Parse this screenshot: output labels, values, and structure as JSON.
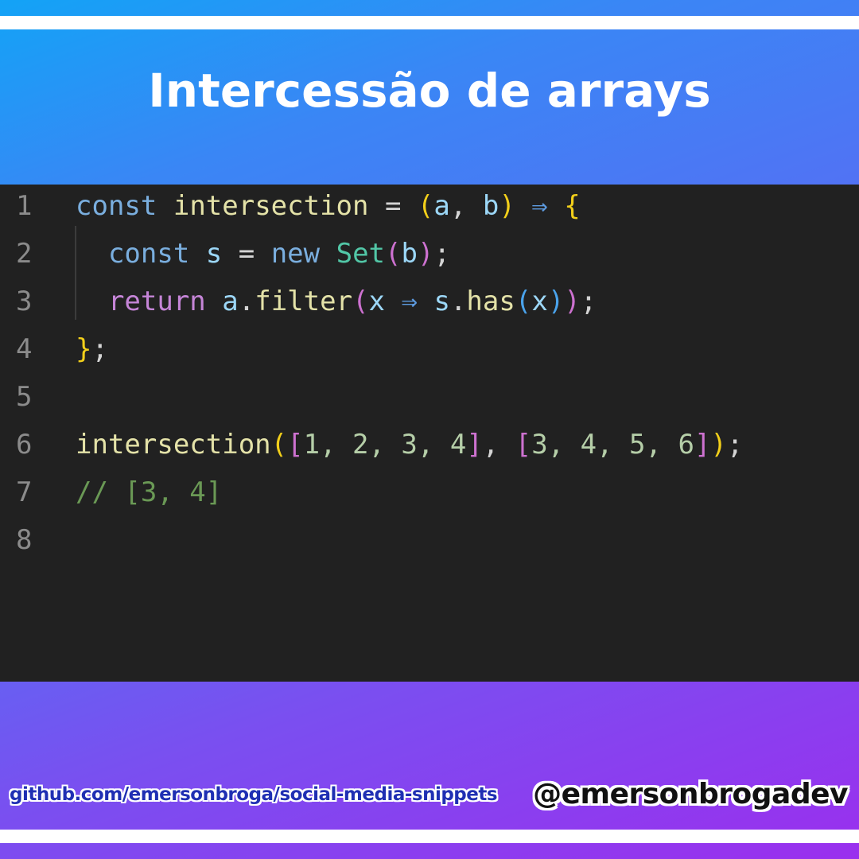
{
  "title": "Intercessão de arrays",
  "code": {
    "lines": [
      {
        "number": "1",
        "tokens": [
          {
            "t": "const",
            "c": "kw"
          },
          {
            "t": " ",
            "c": "plain"
          },
          {
            "t": "intersection",
            "c": "fn"
          },
          {
            "t": " = ",
            "c": "op"
          },
          {
            "t": "(",
            "c": "p1"
          },
          {
            "t": "a",
            "c": "var"
          },
          {
            "t": ", ",
            "c": "op"
          },
          {
            "t": "b",
            "c": "var"
          },
          {
            "t": ")",
            "c": "p1"
          },
          {
            "t": " ⇒ ",
            "c": "arrow"
          },
          {
            "t": "{",
            "c": "p1"
          }
        ]
      },
      {
        "number": "2",
        "tokens": [
          {
            "t": "  ",
            "c": "plain"
          },
          {
            "t": "const",
            "c": "kw"
          },
          {
            "t": " ",
            "c": "plain"
          },
          {
            "t": "s",
            "c": "var"
          },
          {
            "t": " = ",
            "c": "op"
          },
          {
            "t": "new",
            "c": "kw"
          },
          {
            "t": " ",
            "c": "plain"
          },
          {
            "t": "Set",
            "c": "cls"
          },
          {
            "t": "(",
            "c": "p2"
          },
          {
            "t": "b",
            "c": "var"
          },
          {
            "t": ")",
            "c": "p2"
          },
          {
            "t": ";",
            "c": "op"
          }
        ]
      },
      {
        "number": "3",
        "tokens": [
          {
            "t": "  ",
            "c": "plain"
          },
          {
            "t": "return",
            "c": "ret"
          },
          {
            "t": " ",
            "c": "plain"
          },
          {
            "t": "a",
            "c": "var"
          },
          {
            "t": ".",
            "c": "op"
          },
          {
            "t": "filter",
            "c": "fn"
          },
          {
            "t": "(",
            "c": "p2"
          },
          {
            "t": "x",
            "c": "var"
          },
          {
            "t": " ⇒ ",
            "c": "arrow"
          },
          {
            "t": "s",
            "c": "var"
          },
          {
            "t": ".",
            "c": "op"
          },
          {
            "t": "has",
            "c": "fn"
          },
          {
            "t": "(",
            "c": "p3"
          },
          {
            "t": "x",
            "c": "var"
          },
          {
            "t": ")",
            "c": "p3"
          },
          {
            "t": ")",
            "c": "p2"
          },
          {
            "t": ";",
            "c": "op"
          }
        ]
      },
      {
        "number": "4",
        "tokens": [
          {
            "t": "}",
            "c": "p1"
          },
          {
            "t": ";",
            "c": "op"
          }
        ]
      },
      {
        "number": "5",
        "tokens": []
      },
      {
        "number": "6",
        "tokens": [
          {
            "t": "intersection",
            "c": "fn"
          },
          {
            "t": "(",
            "c": "p1"
          },
          {
            "t": "[",
            "c": "p2"
          },
          {
            "t": "1, 2, 3, 4",
            "c": "num"
          },
          {
            "t": "]",
            "c": "p2"
          },
          {
            "t": ", ",
            "c": "op"
          },
          {
            "t": "[",
            "c": "p2"
          },
          {
            "t": "3, 4, 5, 6",
            "c": "num"
          },
          {
            "t": "]",
            "c": "p2"
          },
          {
            "t": ")",
            "c": "p1"
          },
          {
            "t": ";",
            "c": "op"
          }
        ]
      },
      {
        "number": "7",
        "tokens": [
          {
            "t": "// [3, 4]",
            "c": "cmt"
          }
        ]
      },
      {
        "number": "8",
        "tokens": []
      }
    ]
  },
  "footer": {
    "link": "github.com/emersonbroga/social-media-snippets",
    "handle": "@emersonbrogadev"
  }
}
